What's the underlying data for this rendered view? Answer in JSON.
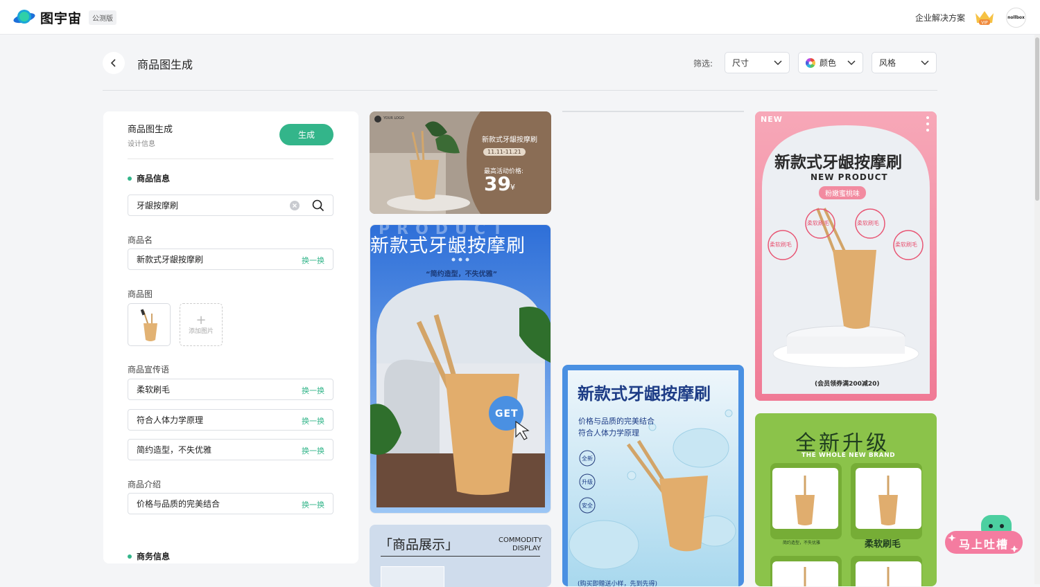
{
  "header": {
    "brand": "图宇宙",
    "beta_badge": "公测版",
    "enterprise_link": "企业解决方案",
    "vip_label": "VIP",
    "avatar_text": "nollbox"
  },
  "toolbar": {
    "page_title": "商品图生成",
    "filter_label": "筛选:",
    "filters": [
      {
        "label": "尺寸"
      },
      {
        "label": "颜色"
      },
      {
        "label": "风格"
      }
    ]
  },
  "panel": {
    "title": "商品图生成",
    "subtitle": "设计信息",
    "generate_label": "生成",
    "product_info": "商品信息",
    "search_value": "牙龈按摩刷",
    "name_label": "商品名",
    "name_value": "新款式牙龈按摩刷",
    "swap_label": "换一换",
    "image_label": "商品图",
    "add_image": "添加图片",
    "slogan_label": "商品宣传语",
    "slogans": [
      "柔软刷毛",
      "符合人体力学原理",
      "简约造型，不失优雅"
    ],
    "intro_label": "商品介绍",
    "intro_value": "价格与品质的完美结合",
    "business_info": "商务信息"
  },
  "gallery": {
    "card1": {
      "logo": "YOUR LOGO",
      "title": "新款式牙龈按摩刷",
      "date": "11.11-11.21",
      "price_label": "最高活动价格:",
      "price": "39",
      "currency": "¥"
    },
    "card2": {
      "title": "新款式牙龈按摩刷",
      "bg_word": "PRODUCT",
      "slogan": "“简约造型，不失优雅”",
      "get": "GET"
    },
    "card3": {
      "title": "「商品展示」",
      "sub1": "COMMODITY",
      "sub2": "DISPLAY"
    },
    "card4": {
      "title": "新款式牙龈按摩刷",
      "line1": "价格与品质的完美结合",
      "line2": "符合人体力学原理",
      "tags": [
        "全新",
        "升级",
        "安全"
      ],
      "footer": "(购买即赠送小样，先到先得)"
    },
    "card5": {
      "new": "NEW",
      "title": "新款式牙龈按摩刷",
      "subtitle": "NEW PRODUCT",
      "flavor": "粉嫩蜜桃味",
      "badges": [
        "柔软刷毛",
        "柔软刷毛",
        "柔软刷毛",
        "柔软刷毛"
      ],
      "footer": "(会员领券满200减20)"
    },
    "card6": {
      "title": "全新升级",
      "subtitle": "THE WHOLE NEW BRAND",
      "cap1": "简约造型，不失优雅",
      "cap2": "柔软刷毛"
    }
  },
  "feedback": {
    "label": "马上吐槽"
  },
  "colors": {
    "accent": "#33b58a",
    "card_brown": "#8a6d55",
    "card_blue": "#4a90e2",
    "card_pink": "#f28ba0",
    "card_green": "#8bc34a"
  }
}
